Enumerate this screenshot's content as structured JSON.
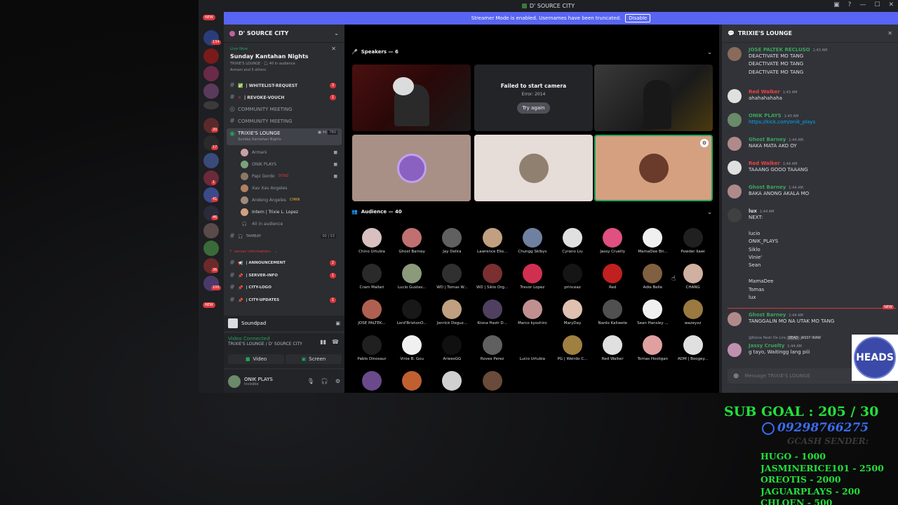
{
  "window": {
    "title": "D' SOURCE CITY"
  },
  "banner": {
    "text": "Streamer Mode is enabled. Usernames have been truncated.",
    "button": "Disable"
  },
  "rail": {
    "new_top": "NEW",
    "badge_1": "134",
    "new_bottom": "NEW",
    "badges": [
      "20",
      "17",
      "1",
      "41",
      "46",
      "36",
      "100"
    ]
  },
  "server": {
    "name": "D' SOURCE CITY"
  },
  "live": {
    "tag": "Live Now",
    "title": "Sunday Kantahan Nights",
    "meta": "TRIXIE'S LOUNGE · 🎧 40 in audience",
    "people": "Armani and 5 others"
  },
  "channels": {
    "whitelist": "| WHITELIST-REQUEST",
    "whitelist_badge": "3",
    "revoke": "| REVOKE-VOUCH",
    "revoke_badge": "1",
    "community1": "COMMUNITY MEETING",
    "community2": "COMMUNITY MEETING",
    "lounge": "TRIXIE'S LOUNGE",
    "lounge_sub": "Sunday Kantahan Nights",
    "lounge_count1": "46",
    "lounge_count2": "780",
    "tambay": "TAMBAY",
    "tambay_c1": "00",
    "tambay_c2": "53",
    "category": "server information.",
    "announcement": "| ANNOUNCEMENT",
    "announcement_badge": "2",
    "serverinfo": "| SERVER-INFO",
    "serverinfo_badge": "1",
    "citylogo": "| CITY-LOGO",
    "cityupdates": "| CITY-UPDATES",
    "cityupdates_badge": "1"
  },
  "voice_users": [
    {
      "name": "Armani",
      "color": "#c9a0a0"
    },
    {
      "name": "ONIK PLAYS",
      "color": "#7aa37a"
    },
    {
      "name": "Papi Gordo",
      "tag": "DONZ",
      "color": "#8a7766"
    },
    {
      "name": "Xav Xav Angeles",
      "color": "#b08060"
    },
    {
      "name": "Andeng Angeles",
      "tag": "CHRN",
      "color": "#a08a7a"
    },
    {
      "name": "Intern | Trixie L. Lopez",
      "color": "#d0a080"
    },
    {
      "name": "40 in audience"
    }
  ],
  "soundpad": {
    "label": "Soundpad"
  },
  "voice": {
    "status": "Video Connected",
    "location": "TRIXIE'S LOUNGE / D' SOURCE CITY",
    "video": "Video",
    "screen": "Screen"
  },
  "user": {
    "name": "ONIK PLAYS",
    "status": "Invisible"
  },
  "stage": {
    "speakers": "Speakers — 6",
    "camera_error": "Failed to start camera",
    "error_code": "Error: 2014",
    "retry": "Try again",
    "audience": "Audience — 40",
    "audience_members": [
      {
        "name": "Chino Urtubia",
        "color": "#d8c0c0"
      },
      {
        "name": "Ghost Barney",
        "color": "#c07070"
      },
      {
        "name": "Jay Delira",
        "color": "#606060"
      },
      {
        "name": "Lawrence Elio...",
        "color": "#c0a080"
      },
      {
        "name": "Chungg Sklbys",
        "color": "#7080a0"
      },
      {
        "name": "Cyrano Liu",
        "color": "#e0e0e0"
      },
      {
        "name": "Jassy Cruelty",
        "color": "#e05080"
      },
      {
        "name": "MamaDee Bir...",
        "color": "#f0f0f0"
      },
      {
        "name": "Powder Ilawi",
        "color": "#202020"
      },
      {
        "name": "Cram Mallari",
        "color": "#2a2a2a"
      },
      {
        "name": "Lucio Gustav...",
        "color": "#8a9a7a"
      },
      {
        "name": "WD | Tomas W...",
        "color": "#303030"
      },
      {
        "name": "WD | Siklo Org...",
        "color": "#7a3030"
      },
      {
        "name": "Trevor Lopez",
        "color": "#d03050"
      },
      {
        "name": "princeaz",
        "color": "#151515"
      },
      {
        "name": "Red",
        "color": "#c02020"
      },
      {
        "name": "Adie Belle",
        "color": "#806040"
      },
      {
        "name": "CHANG",
        "color": "#d0b0a0"
      },
      {
        "name": "JOSE PALTEK...",
        "color": "#b06050"
      },
      {
        "name": "Lord'BrixtonO...",
        "color": "#181818"
      },
      {
        "name": "Jenrick Deguz...",
        "color": "#c0a080"
      },
      {
        "name": "Kiona Hezir D...",
        "color": "#504060"
      },
      {
        "name": "Marco kyoshiro",
        "color": "#c09090"
      },
      {
        "name": "MaryDay",
        "color": "#e0c0b0"
      },
      {
        "name": "Nardo Kaliwete",
        "color": "#505050"
      },
      {
        "name": "Sean Hansley ...",
        "color": "#f0f0f0"
      },
      {
        "name": "wazeyxz",
        "color": "#9a7a40"
      },
      {
        "name": "Pablo Dinosaur",
        "color": "#202020"
      },
      {
        "name": "Vinie B. Gou",
        "color": "#f0f0f0"
      },
      {
        "name": "ArieesGG",
        "color": "#101010"
      },
      {
        "name": "Rovex Perez",
        "color": "#606060"
      },
      {
        "name": "Lucio Urtubia",
        "color": "#000000"
      },
      {
        "name": "PG | Weirdo C...",
        "color": "#a08040"
      },
      {
        "name": "Red Walker",
        "color": "#e0e0e0"
      },
      {
        "name": "Tomas Hooligan",
        "color": "#e0a0a0"
      },
      {
        "name": "ADM | Boogey...",
        "color": "#e0e0e0"
      }
    ]
  },
  "chat": {
    "title": "TRIXIE'S LOUNGE",
    "messages": [
      {
        "author": "JOSE PALTEK RECLUSO",
        "time": "1:43 AM",
        "color": "#3ba55c",
        "lines": [
          "DEACTIVATE MO TANG",
          "DEACTIVATE MO TANG",
          "DEACTIVATE MO TANG"
        ]
      },
      {
        "author": "Red Walker",
        "time": "1:43 AM",
        "color": "#ed4245",
        "lines": [
          "ahahahahaha"
        ]
      },
      {
        "author": "ONIK PLAYS",
        "time": "1:43 AM",
        "color": "#3ba55c",
        "lines": [
          "https://kick.com/onik_plays"
        ]
      },
      {
        "author": "Ghost Barney",
        "time": "1:44 AM",
        "color": "#3ba55c",
        "lines": [
          "NAKA MATA AKO OY"
        ]
      },
      {
        "author": "Red Walker",
        "time": "1:44 AM",
        "color": "#ed4245",
        "lines": [
          "TAAANG GOOO TAAANG"
        ]
      },
      {
        "author": "Ghost Barney",
        "time": "1:44 AM",
        "color": "#3ba55c",
        "lines": [
          "BAKA ANONG AKALA MO"
        ]
      },
      {
        "author": "lux",
        "time": "1:44 AM",
        "color": "#dbdee1",
        "lines": [
          "NEXT:",
          "",
          "lucio",
          "ONIK_PLAYS",
          "Siklo",
          "Vinie'",
          "Sean",
          "",
          "MamaDee",
          "Tomas",
          "lux"
        ]
      },
      {
        "author": "Ghost Barney",
        "time": "1:44 AM",
        "color": "#3ba55c",
        "lines": [
          "TANGGALIN MO NA UTAK MO TANG"
        ]
      },
      {
        "author": "Jassy Cruelty",
        "time": "1:44 AM",
        "color": "#3ba55c",
        "lines": [
          "g tayo, Waitingg lang piii"
        ]
      }
    ],
    "new_label": "NEW",
    "reply_preview": "@Kiona Hezir De Lira",
    "reply_tag": "DEAD",
    "reply_author": "JASSY IKAW",
    "placeholder": "Message TRIXIE'S LOUNGE"
  },
  "overlay": {
    "heads": "HEADS",
    "sub_goal": "SUB GOAL : 205 / 30",
    "gcash": "09298766275",
    "gcash_label": "GCASH SENDER:",
    "senders": [
      "HUGO - 1000",
      "JASMINERICE101 - 2500",
      "OREOTIS - 2000",
      "JAGUARPLAYS - 200",
      "CHLOEN - 500"
    ]
  }
}
